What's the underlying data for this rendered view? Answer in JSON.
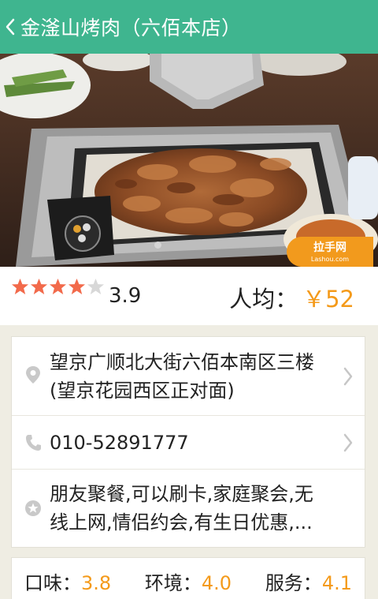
{
  "header": {
    "back_icon": "chevron-left-icon",
    "title": "金滏山烤肉（六佰本店）",
    "background_color": "#3fb58f"
  },
  "photo": {
    "watermark_brand": "拉手网",
    "watermark_url": "Lashou.com",
    "carousel_page": 1
  },
  "rating": {
    "stars_value": 4,
    "stars_max": 5,
    "score": "3.9",
    "avg_label": "人均：",
    "avg_price": "￥52",
    "accent_color": "#f49a1a"
  },
  "info": {
    "address": "望京广顺北大街六佰本南区三楼(望京花园西区正对面)",
    "phone": "010-52891777",
    "tags": "朋友聚餐,可以刷卡,家庭聚会,无线上网,情侣约会,有生日优惠,..."
  },
  "scores": {
    "taste_label": "口味：",
    "taste_value": "3.8",
    "env_label": "环境：",
    "env_value": "4.0",
    "service_label": "服务：",
    "service_value": "4.1"
  }
}
